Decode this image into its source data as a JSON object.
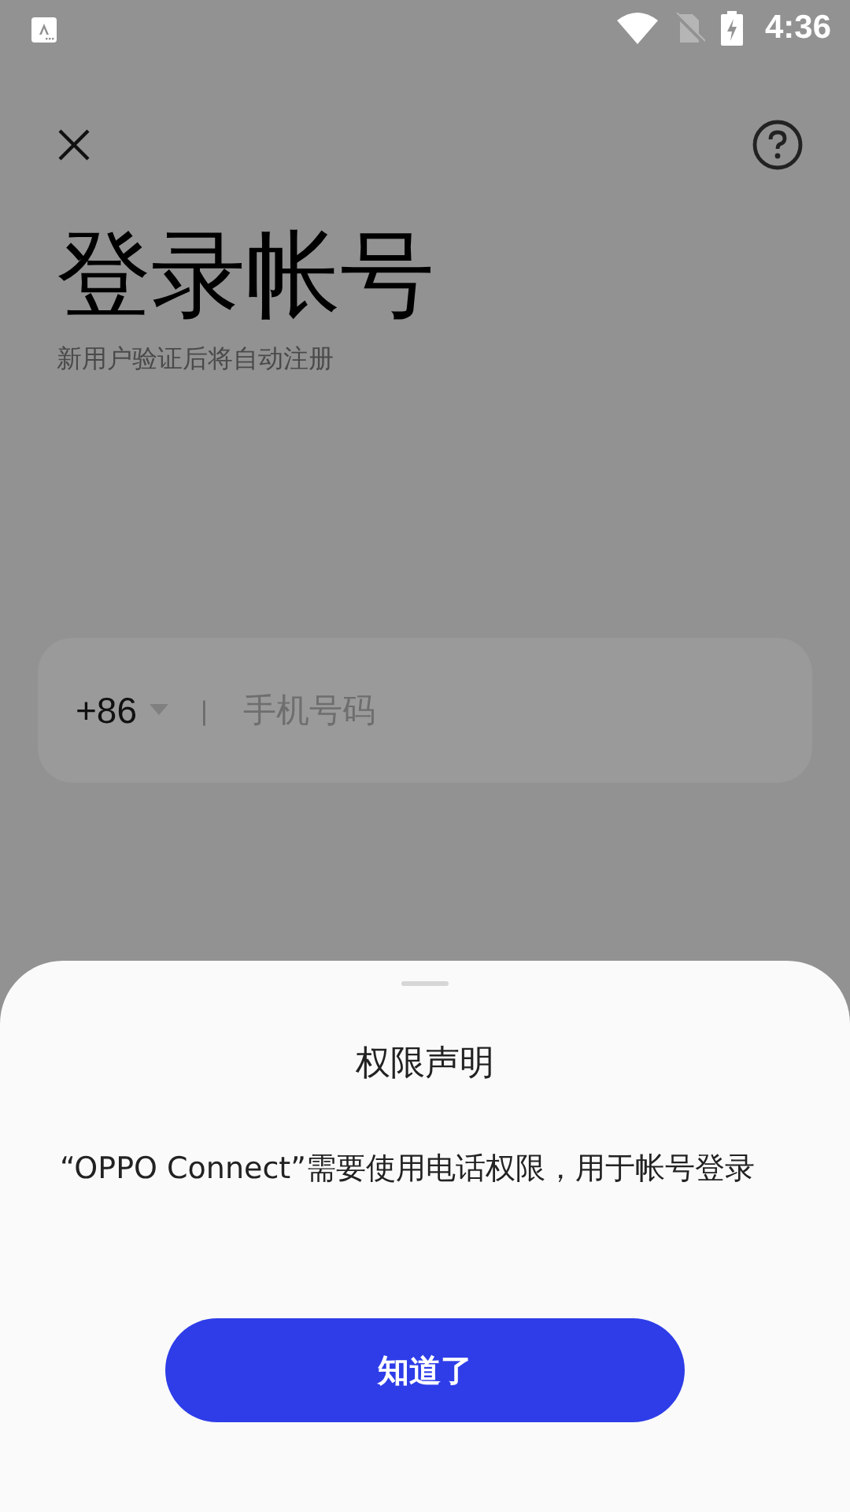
{
  "status_bar": {
    "time": "4:36"
  },
  "header": {
    "title": "登录帐号",
    "subtitle": "新用户验证后将自动注册"
  },
  "phone_field": {
    "country_code": "+86",
    "separator": "|",
    "placeholder": "手机号码"
  },
  "dialog": {
    "title": "权限声明",
    "message": "“OPPO Connect”需要使用电话权限，用于帐号登录",
    "button": "知道了"
  }
}
